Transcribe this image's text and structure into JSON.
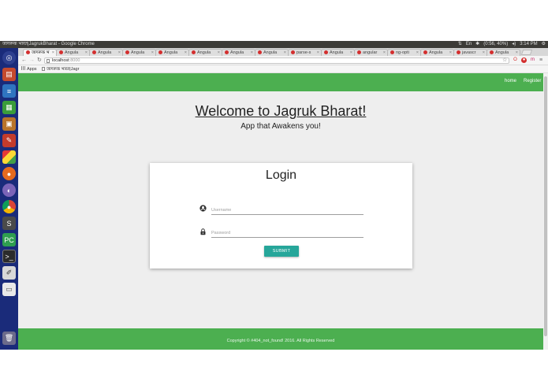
{
  "os": {
    "window_title": "जागरूक भारत|JagrukBharat - Google Chrome",
    "tray": {
      "battery": "(0:56, 40%)",
      "volume": "◂)",
      "time": "3:14 PM"
    }
  },
  "launcher": {
    "icons": [
      "ubuntu-dash-icon",
      "files-icon",
      "libreoffice-writer-icon",
      "libreoffice-calc-icon",
      "archive-icon",
      "text-editor-icon",
      "software-center-icon",
      "firefox-icon",
      "app-icon",
      "chrome-icon",
      "sublime-text-icon",
      "pycharm-icon",
      "terminal-icon",
      "editor-icon",
      "drive-icon",
      "trash-icon"
    ]
  },
  "browser": {
    "tabs": [
      {
        "label": "जागरूक भ",
        "active": true
      },
      {
        "label": "Angula",
        "active": false
      },
      {
        "label": "Angula",
        "active": false
      },
      {
        "label": "Angula",
        "active": false
      },
      {
        "label": "Angula",
        "active": false
      },
      {
        "label": "Angula",
        "active": false
      },
      {
        "label": "Angula",
        "active": false
      },
      {
        "label": "Angula",
        "active": false
      },
      {
        "label": "parse-s",
        "active": false
      },
      {
        "label": "Angula",
        "active": false
      },
      {
        "label": "angular",
        "active": false
      },
      {
        "label": "ng-opti",
        "active": false
      },
      {
        "label": "Angula",
        "active": false
      },
      {
        "label": "javascr",
        "active": false
      },
      {
        "label": "Angula",
        "active": false
      }
    ],
    "url_host": "localhost",
    "url_port": ":8000",
    "bookmarks": {
      "apps_label": "Apps",
      "bookmark_1": "जागरूक भारत|Jagr"
    }
  },
  "page": {
    "nav": {
      "home": "home",
      "register": "Register"
    },
    "welcome": "Welcome to Jagruk Bharat!",
    "tagline": "App that Awakens you!",
    "login": {
      "title": "Login",
      "username_placeholder": "Username",
      "password_placeholder": "Password",
      "submit": "SUBMIT"
    },
    "footer": "Copyright © #404_not_found! 2016. All Rights Reserved"
  },
  "colors": {
    "primary": "#4caf50",
    "button": "#26a69a",
    "launcher": "#1a2b7a"
  }
}
